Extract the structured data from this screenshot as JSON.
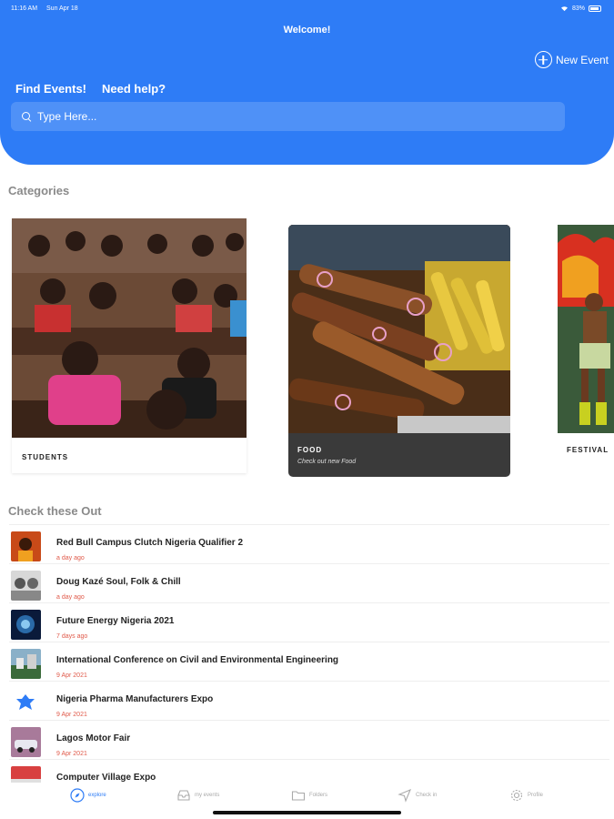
{
  "status_bar": {
    "time": "11:16 AM",
    "date": "Sun Apr 18",
    "battery": "83%"
  },
  "header": {
    "title": "Welcome!",
    "new_event_label": "New Event",
    "links": [
      "Find Events!",
      "Need help?"
    ],
    "search_placeholder": "Type Here..."
  },
  "categories": {
    "title": "Categories",
    "items": [
      {
        "label": "STUDENTS",
        "subtitle": ""
      },
      {
        "label": "FOOD",
        "subtitle": "Check out new Food"
      },
      {
        "label": "FESTIVAL",
        "subtitle": ""
      }
    ]
  },
  "check_out": {
    "title": "Check these Out",
    "events": [
      {
        "title": "Red Bull Campus Clutch Nigeria Qualifier 2",
        "date": "a day ago"
      },
      {
        "title": "Doug Kazé Soul, Folk & Chill",
        "date": "a day ago"
      },
      {
        "title": "Future Energy Nigeria 2021",
        "date": "7 days ago"
      },
      {
        "title": "International Conference on Civil and Environmental Engineering",
        "date": "9 Apr 2021"
      },
      {
        "title": "Nigeria Pharma Manufacturers Expo",
        "date": "9 Apr 2021"
      },
      {
        "title": "Lagos Motor Fair",
        "date": "9 Apr 2021"
      },
      {
        "title": "Computer Village Expo",
        "date": ""
      }
    ]
  },
  "tabbar": {
    "tabs": [
      {
        "label": "explore",
        "icon": "compass-icon",
        "active": true
      },
      {
        "label": "my events",
        "icon": "inbox-icon",
        "active": false
      },
      {
        "label": "Folders",
        "icon": "folder-icon",
        "active": false
      },
      {
        "label": "Check in",
        "icon": "send-icon",
        "active": false
      },
      {
        "label": "Profile",
        "icon": "gear-icon",
        "active": false
      }
    ]
  },
  "colors": {
    "primary": "#2e7cf6",
    "date_accent": "#e05a4a"
  }
}
